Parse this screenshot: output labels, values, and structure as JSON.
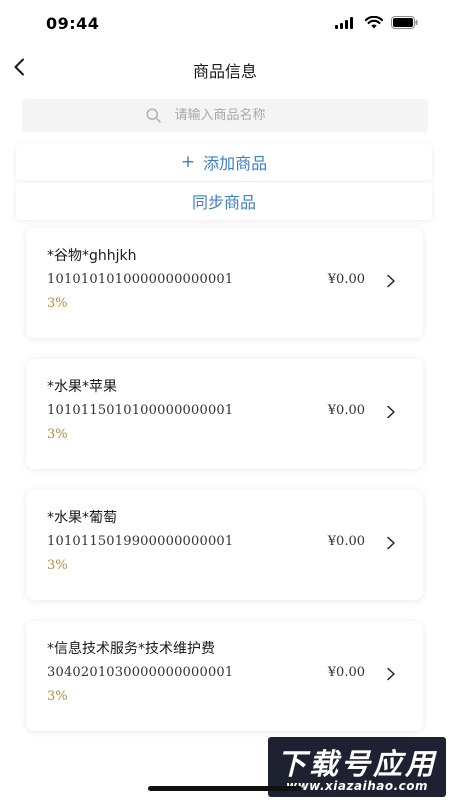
{
  "status_bar": {
    "time": "09:44",
    "signal_icon": "signal-bars-icon",
    "wifi_icon": "wifi-icon",
    "battery_icon": "battery-icon"
  },
  "header": {
    "back_icon": "chevron-left-icon",
    "title": "商品信息"
  },
  "search": {
    "icon": "search-icon",
    "placeholder": "请输入商品名称",
    "value": ""
  },
  "actions": {
    "add_icon": "+",
    "add_label": "添加商品",
    "sync_label": "同步商品"
  },
  "products": [
    {
      "name": "*谷物*ghhjkh",
      "code": "1010101010000000000001",
      "price": "¥0.00",
      "tax_rate": "3%"
    },
    {
      "name": "*水果*苹果",
      "code": "1010115010100000000001",
      "price": "¥0.00",
      "tax_rate": "3%"
    },
    {
      "name": "*水果*葡萄",
      "code": "1010115019900000000001",
      "price": "¥0.00",
      "tax_rate": "3%"
    },
    {
      "name": "*信息技术服务*技术维护费",
      "code": "3040201030000000000001",
      "price": "¥0.00",
      "tax_rate": "3%"
    }
  ],
  "watermark": {
    "title": "下载号应用",
    "url": "www.xiazaihao.com"
  },
  "colors": {
    "accent_blue": "#3d7fc6",
    "tax_gold": "#b38f3e",
    "search_bg": "#f4f4f4"
  }
}
